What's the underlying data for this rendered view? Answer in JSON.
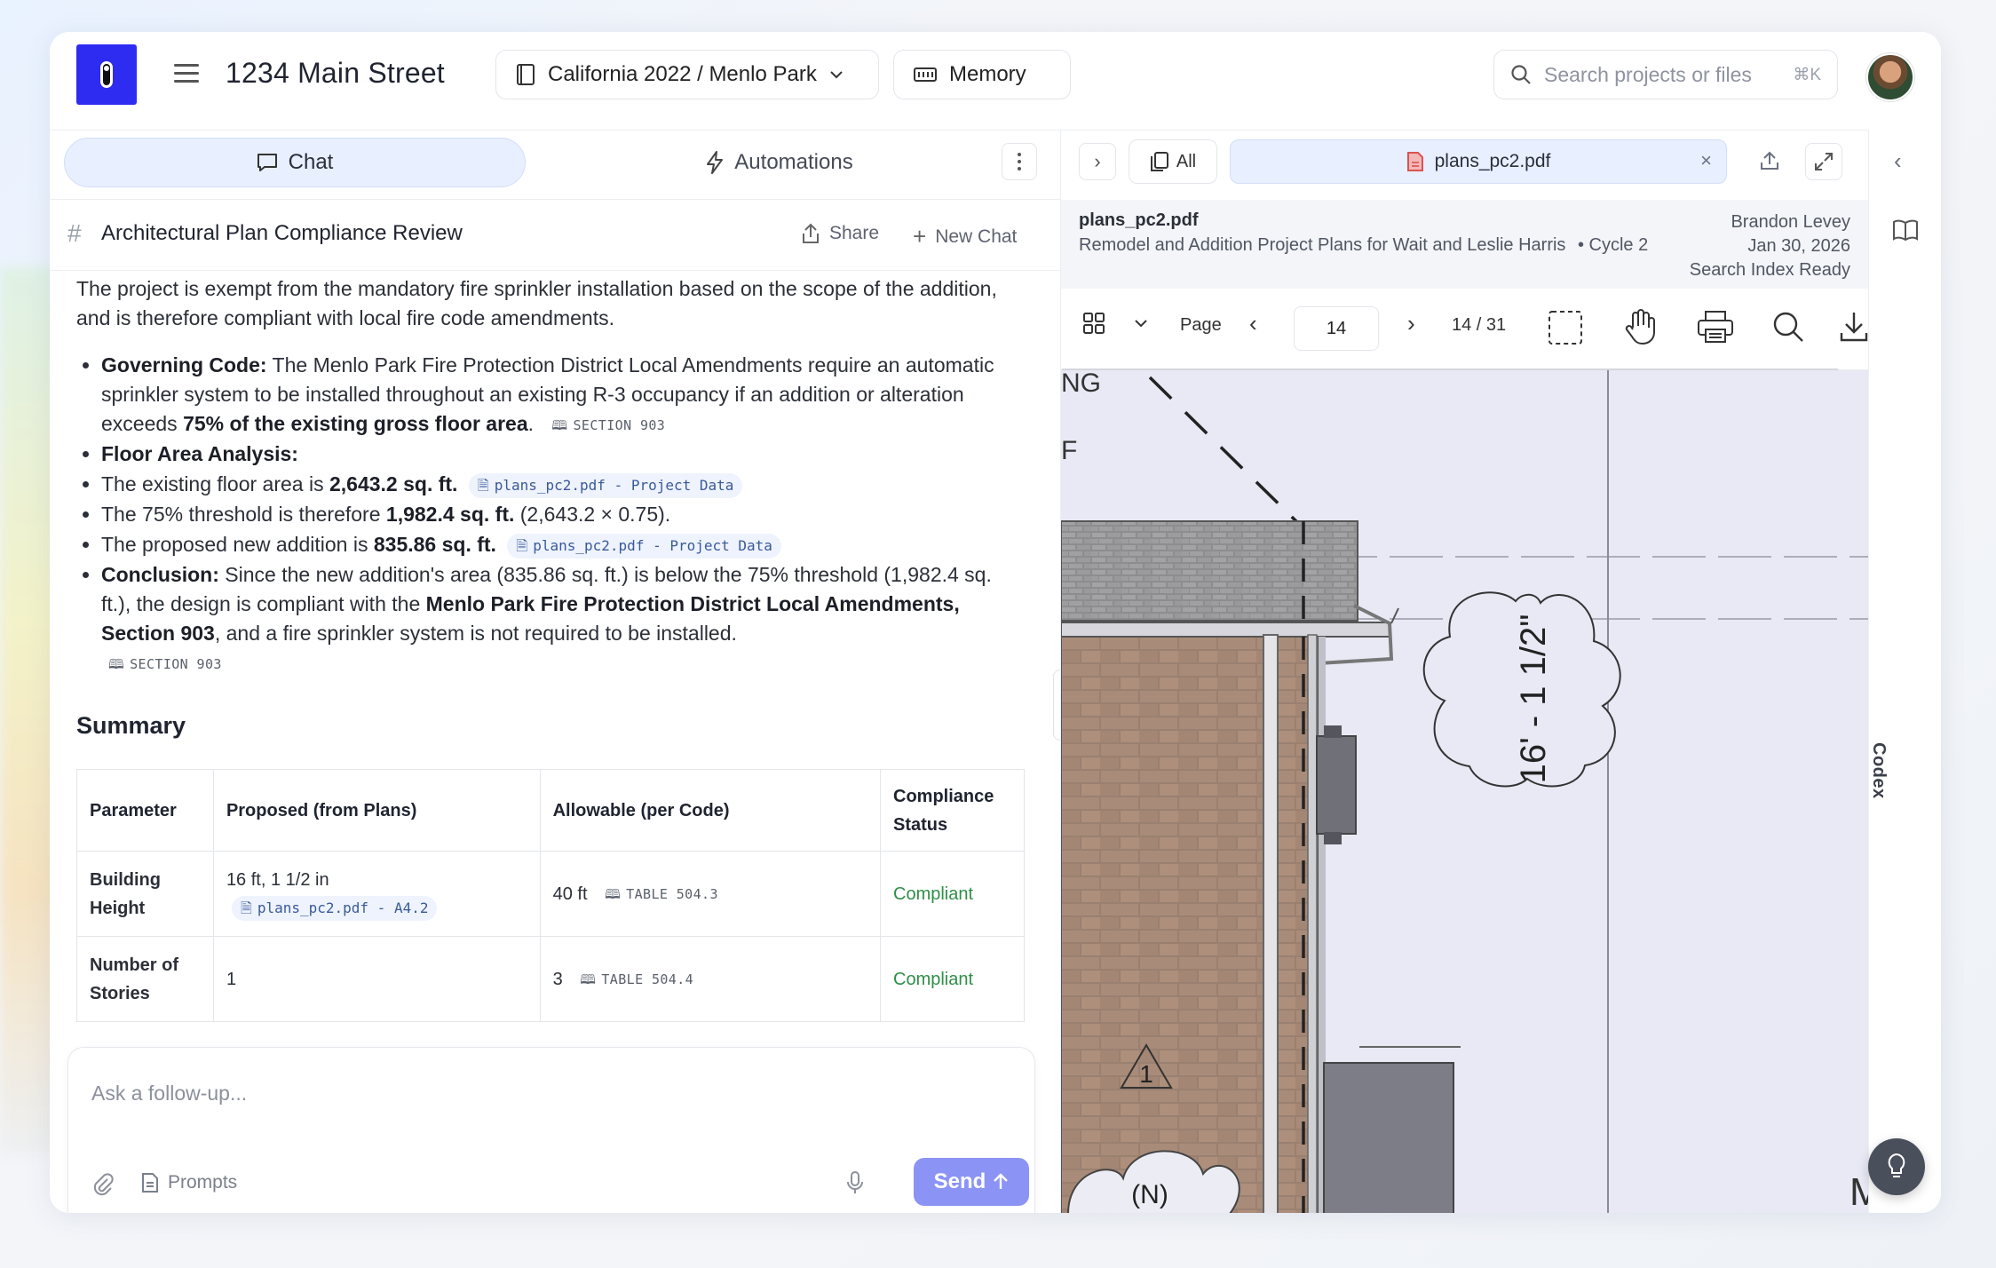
{
  "header": {
    "project_title": "1234 Main Street",
    "location": "California 2022 / Menlo Park",
    "memory_label": "Memory",
    "search_placeholder": "Search projects or files",
    "search_shortcut": "⌘K"
  },
  "tabs": {
    "chat": "Chat",
    "automations": "Automations"
  },
  "chat": {
    "title": "Architectural Plan Compliance Review",
    "share_label": "Share",
    "new_chat_label": "New Chat",
    "intro": "The project is exempt from the mandatory fire sprinkler installation based on the scope of the addition, and is therefore compliant with local fire code amendments.",
    "bullets": {
      "governing_label": "Governing Code:",
      "governing_text": "The Menlo Park Fire Protection District Local Amendments require an automatic sprinkler system to be installed throughout an existing R-3 occupancy if an addition or alteration exceeds",
      "governing_bold": "75% of the existing gross floor area",
      "governing_cite": "SECTION 903",
      "floor_label": "Floor Area Analysis:",
      "existing_text": "The existing floor area is",
      "existing_value": "2,643.2 sq. ft.",
      "existing_cite": "plans_pc2.pdf - Project Data",
      "threshold_text": "The 75% threshold is therefore",
      "threshold_value": "1,982.4 sq. ft.",
      "threshold_calc": "(2,643.2 × 0.75).",
      "proposed_text": "The proposed new addition is",
      "proposed_value": "835.86 sq. ft.",
      "proposed_cite": "plans_pc2.pdf - Project Data",
      "conclusion_label": "Conclusion:",
      "conclusion_text1": "Since the new addition's area (835.86 sq. ft.) is below the 75% threshold (1,982.4 sq. ft.), the design is compliant with the",
      "conclusion_bold": "Menlo Park Fire Protection District Local Amendments, Section 903",
      "conclusion_text2": ", and a fire sprinkler system is not required to be installed.",
      "conclusion_cite": "SECTION 903"
    },
    "summary_heading": "Summary",
    "table": {
      "headers": [
        "Parameter",
        "Proposed (from Plans)",
        "Allowable (per Code)",
        "Compliance Status"
      ],
      "rows": [
        {
          "param": "Building Height",
          "proposed": "16 ft, 1 1/2 in",
          "proposed_cite": "plans_pc2.pdf - A4.2",
          "allowable": "40 ft",
          "allowable_cite": "TABLE 504.3",
          "status": "Compliant"
        },
        {
          "param": "Number of Stories",
          "proposed": "1",
          "proposed_cite": "",
          "allowable": "3",
          "allowable_cite": "TABLE 504.4",
          "status": "Compliant"
        }
      ]
    },
    "composer_placeholder": "Ask a follow-up...",
    "prompts_label": "Prompts",
    "send_label": "Send"
  },
  "viewer": {
    "all_label": "All",
    "file_tab": "plans_pc2.pdf",
    "file_name": "plans_pc2.pdf",
    "file_desc": "Remodel and Addition Project Plans for Wait and Leslie Harris",
    "cycle": "• Cycle 2",
    "author": "Brandon Levey",
    "date": "Jan 30, 2026",
    "index_status": "Search Index Ready",
    "page_label": "Page",
    "page_value": "14",
    "page_count": "14 / 31",
    "drawing": {
      "dimension": "16' - 1 1/2\"",
      "tag_n": "(N)",
      "triangle_num": "1",
      "partial_text_top": "NG",
      "partial_text_f": "F",
      "partial_text_m": "M"
    }
  },
  "rail": {
    "codex_label": "Codex"
  },
  "colors": {
    "brand": "#2f2cf2",
    "accent_tab": "#e8efff",
    "send_button": "#8b93f5",
    "compliant": "#2f8f47"
  }
}
